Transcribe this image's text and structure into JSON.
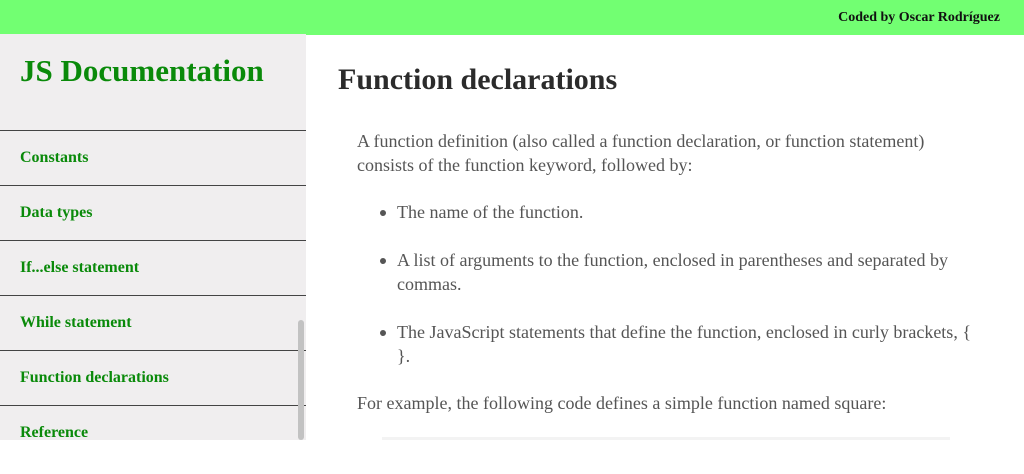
{
  "header": {
    "credit": "Coded by Oscar Rodríguez"
  },
  "sidebar": {
    "title": "JS Documentation",
    "items": [
      {
        "label": "Constants"
      },
      {
        "label": "Data types"
      },
      {
        "label": "If...else statement"
      },
      {
        "label": "While statement"
      },
      {
        "label": "Function declarations"
      },
      {
        "label": "Reference"
      }
    ]
  },
  "main": {
    "title": "Function declarations",
    "intro": "A function definition (also called a function declaration, or function statement) consists of the function keyword, followed by:",
    "bullets": [
      "The name of the function.",
      "A list of arguments to the function, enclosed in parentheses and separated by commas.",
      "The JavaScript statements that define the function, enclosed in curly brackets, { }."
    ],
    "example": "For example, the following code defines a simple function named square:"
  },
  "colors": {
    "topbar": "#72ff72",
    "sidebar_bg": "#f0eeef",
    "link": "#0a8a0a",
    "text": "#555555"
  }
}
